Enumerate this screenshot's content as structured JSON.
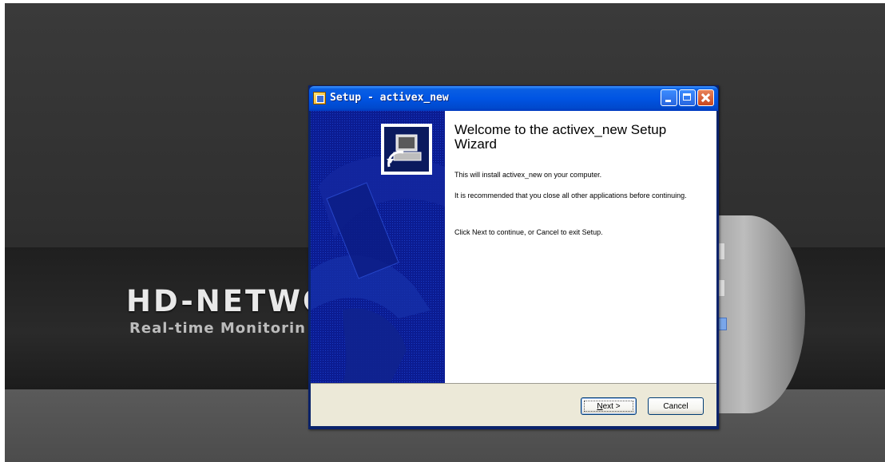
{
  "background": {
    "logo_title": "HD-NETWO",
    "logo_subtitle": "Real-time Monitorin"
  },
  "dialog": {
    "title": "Setup - activex_new",
    "heading": "Welcome to the activex_new Setup Wizard",
    "paragraphs": [
      "This will install activex_new on your computer.",
      "It is recommended that you close all other applications before continuing.",
      "Click Next to continue, or Cancel to exit Setup."
    ],
    "buttons": {
      "next_mnemonic": "N",
      "next_rest": "ext >",
      "cancel": "Cancel"
    }
  },
  "colors": {
    "titlebar": "#0054e3",
    "side_panel": "#0a1a8a",
    "footer": "#ece9d8"
  },
  "icons": [
    "setup-icon",
    "minimize-icon",
    "maximize-icon",
    "close-icon",
    "computer-setup-icon"
  ]
}
